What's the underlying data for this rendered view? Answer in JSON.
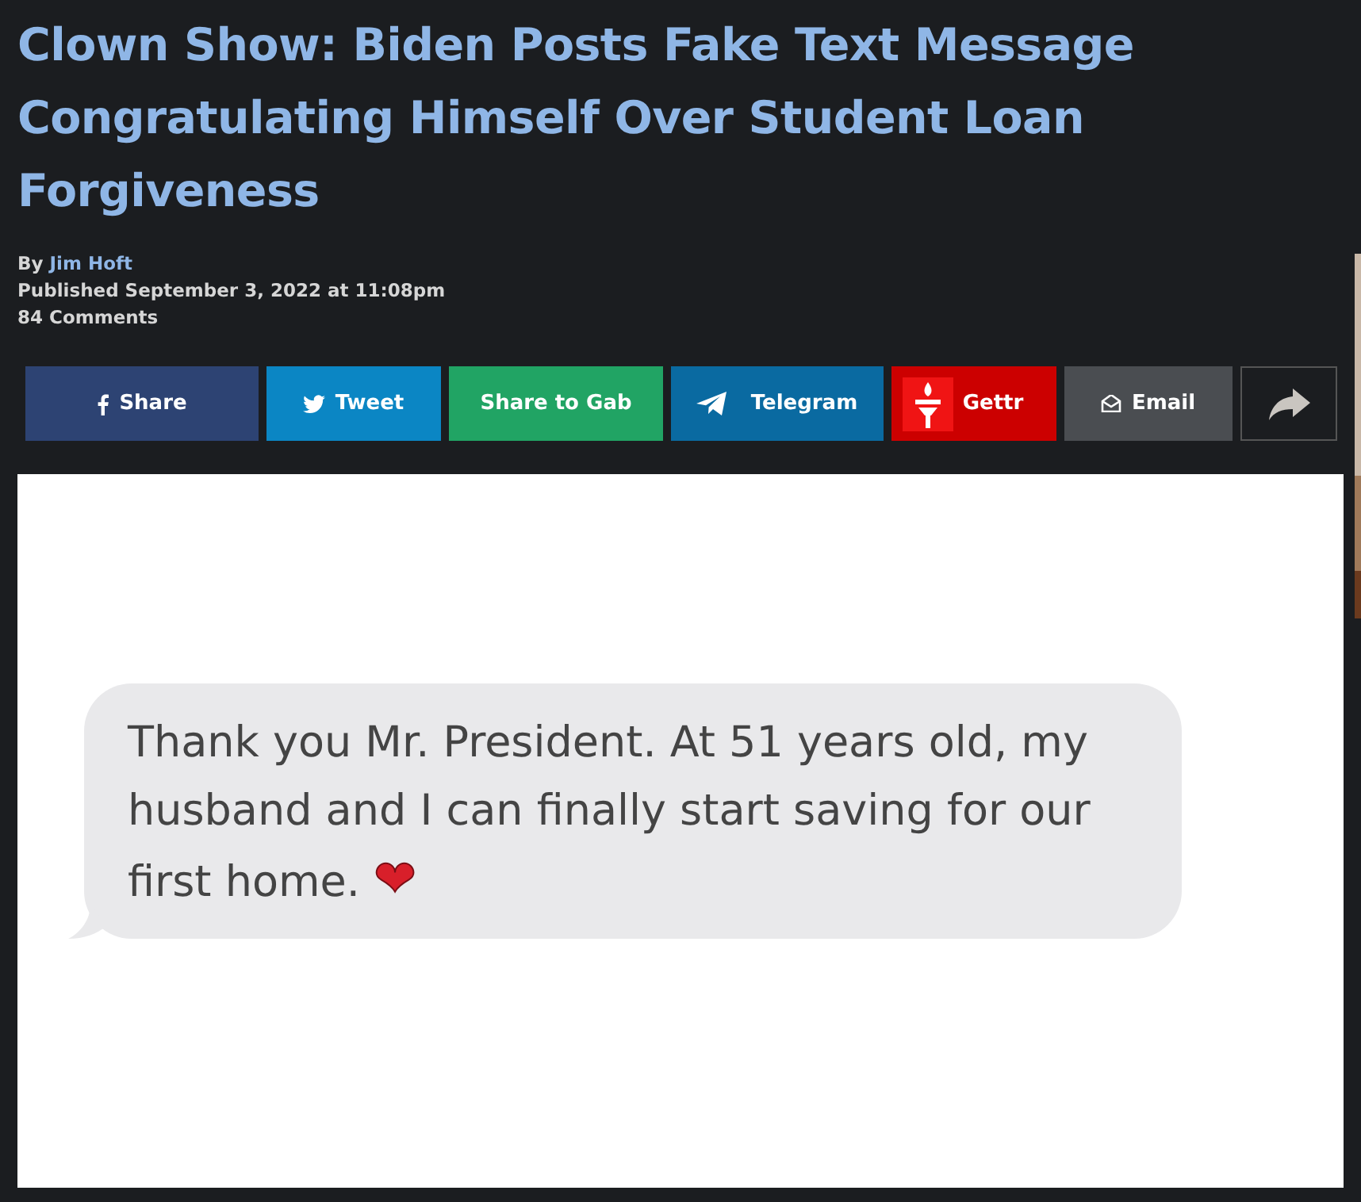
{
  "article": {
    "title": "Clown Show: Biden Posts Fake Text Message Congratulating Himself Over Student Loan Forgiveness",
    "byline_prefix": "By",
    "author": "Jim Hoft",
    "published": "Published September 3, 2022 at 11:08pm",
    "comments": "84 Comments"
  },
  "share_buttons": [
    {
      "kind": "facebook",
      "label": "Share",
      "color": "#2d4373"
    },
    {
      "kind": "twitter",
      "label": "Tweet",
      "color": "#0b86c4"
    },
    {
      "kind": "gab",
      "label": "Share to Gab",
      "color": "#21a464"
    },
    {
      "kind": "telegram",
      "label": "Telegram",
      "color": "#0a6aa1"
    },
    {
      "kind": "gettr",
      "label": "Gettr",
      "color": "#cc0000"
    },
    {
      "kind": "email",
      "label": "Email",
      "color": "#4a4d51"
    },
    {
      "kind": "more",
      "color": "#1b1d20"
    }
  ],
  "message": {
    "text": "Thank you Mr. President. At 51 years old, my husband and I can finally start saving for our first home.",
    "emoji": "❤"
  }
}
